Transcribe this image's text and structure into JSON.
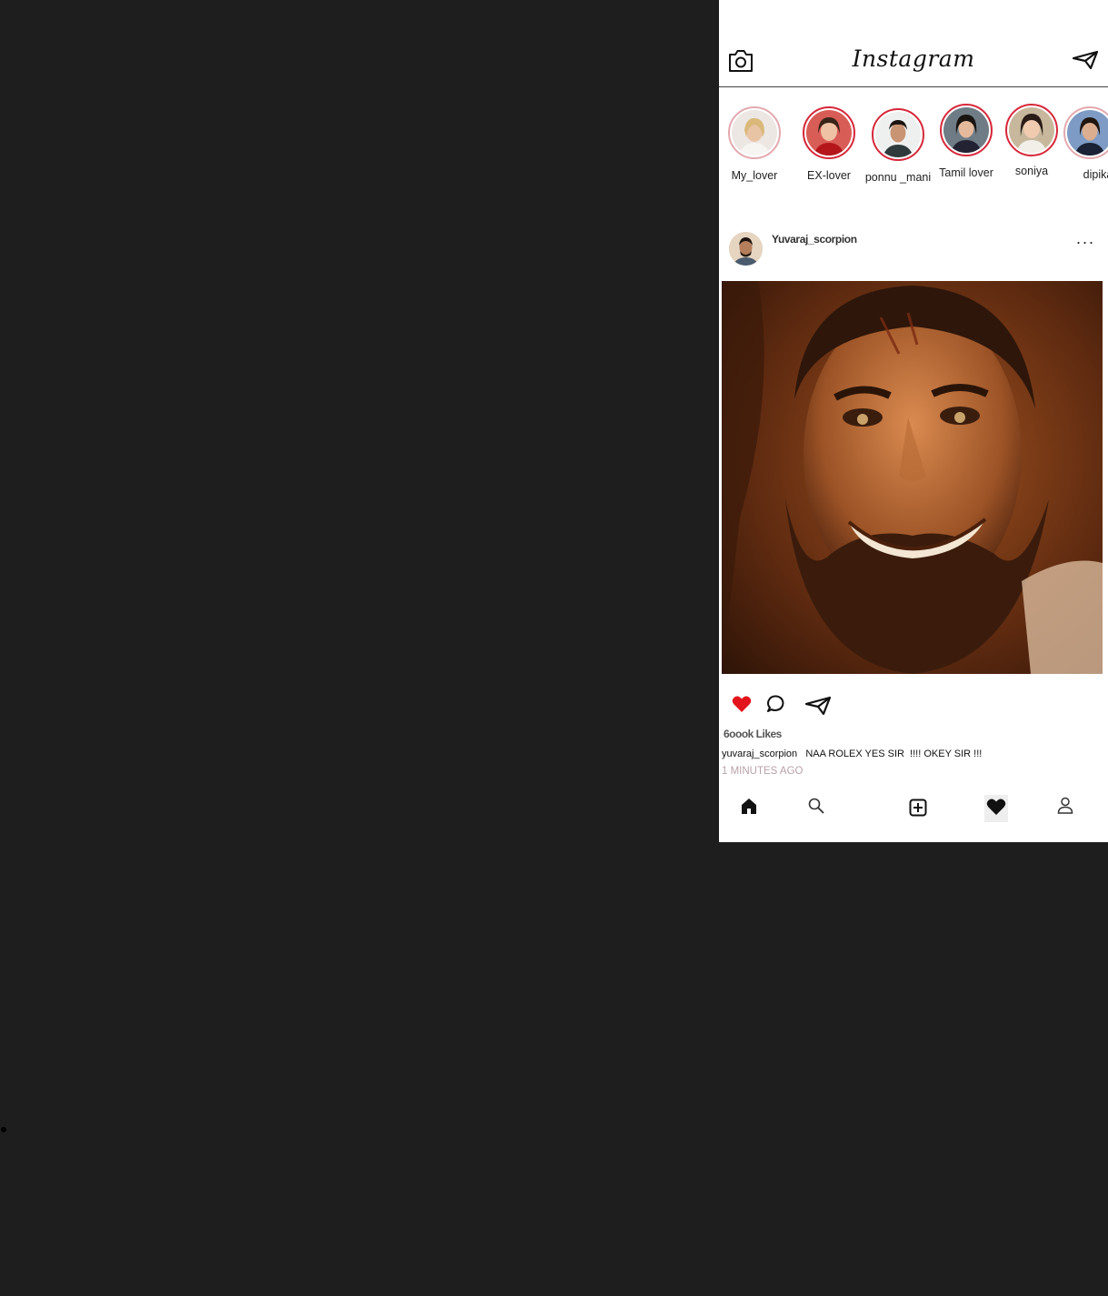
{
  "app": {
    "logo_text": "Instagram"
  },
  "stories": [
    {
      "name": "My_lover"
    },
    {
      "name": "EX-lover"
    },
    {
      "name": "ponnu _mani"
    },
    {
      "name": "Tamil lover"
    },
    {
      "name": "soniya"
    },
    {
      "name": "dipika"
    }
  ],
  "post": {
    "username": "Yuvaraj_scorpion",
    "more_label": "...",
    "likes": "6oook Likes",
    "caption_user": "yuvaraj_scorpion",
    "caption_text": "NAA ROLEX YES SIR  !!!! OKEY SIR !!!",
    "time": "1 MINUTES AGO"
  },
  "colors": {
    "accent_red": "#e3141b",
    "story_ring": "#d6283a",
    "page_bg": "#1e1e1f"
  },
  "icons": {
    "top_left": "camera-icon",
    "top_right": "send-icon",
    "post_actions": [
      "heart-filled-icon",
      "comment-icon",
      "share-icon"
    ],
    "bottom_nav": [
      "home-icon",
      "search-icon",
      "add-post-icon",
      "heart-icon",
      "profile-icon"
    ]
  }
}
